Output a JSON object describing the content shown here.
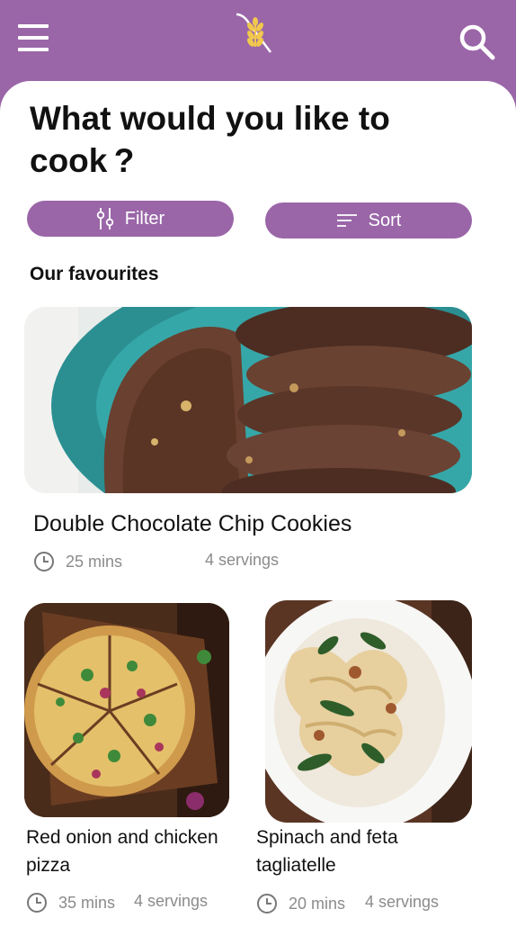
{
  "header": {
    "menu_icon": "hamburger-menu-icon",
    "logo_icon": "wheat-logo-icon",
    "search_icon": "search-icon"
  },
  "heading": "What would you like to cook ?",
  "buttons": {
    "filter": "Filter",
    "sort": "Sort"
  },
  "section_title": "Our favourites",
  "recipes": [
    {
      "title": "Double Chocolate Chip Cookies",
      "time": "25 mins",
      "servings": "4 servings"
    },
    {
      "title": "Red onion and chicken pizza",
      "time": "35 mins",
      "servings": "4 servings"
    },
    {
      "title": "Spinach and feta tagliatelle",
      "time": "20 mins",
      "servings": "4 servings"
    }
  ],
  "colors": {
    "brand": "#9a66a8",
    "logo_gold": "#f2c94c",
    "text": "#111111",
    "meta_text": "#8b8b8b"
  }
}
